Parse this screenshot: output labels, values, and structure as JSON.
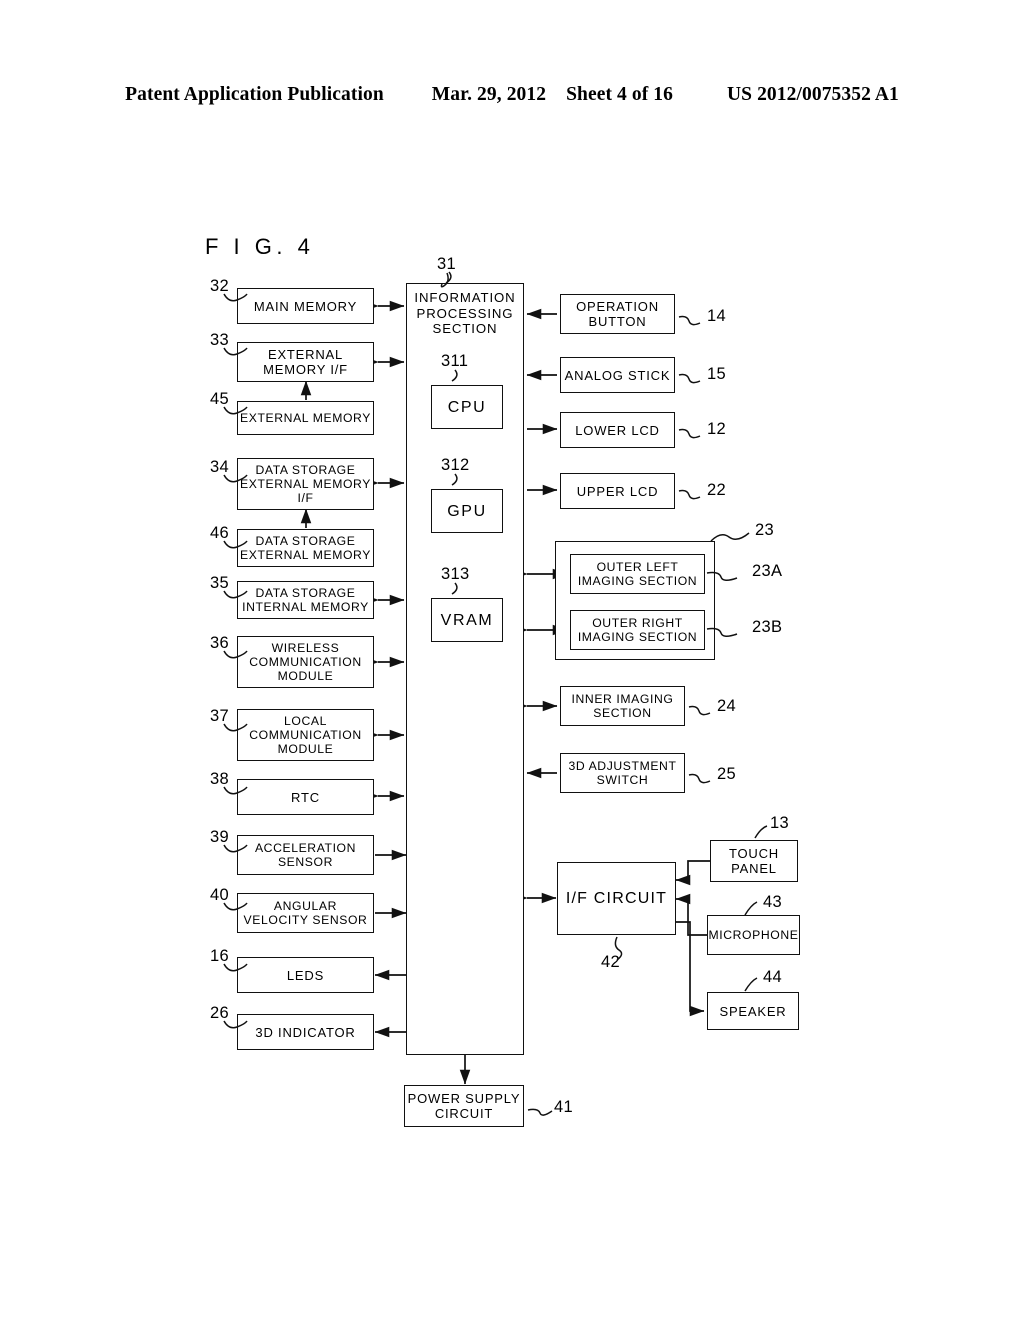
{
  "header": {
    "left": "Patent Application Publication",
    "date": "Mar. 29, 2012",
    "sheet": "Sheet 4 of 16",
    "pub_number": "US 2012/0075352 A1"
  },
  "figure": {
    "label": "F I G.  4"
  },
  "blocks": {
    "main_memory": {
      "label": "MAIN MEMORY",
      "ref": "32"
    },
    "external_memory_if": {
      "label": "EXTERNAL\nMEMORY I/F",
      "ref": "33"
    },
    "external_memory": {
      "label": "EXTERNAL MEMORY",
      "ref": "45"
    },
    "ds_external_memory_if": {
      "label": "DATA STORAGE\nEXTERNAL MEMORY\nI/F",
      "ref": "34"
    },
    "ds_external_memory": {
      "label": "DATA STORAGE\nEXTERNAL MEMORY",
      "ref": "46"
    },
    "ds_internal_memory": {
      "label": "DATA STORAGE\nINTERNAL MEMORY",
      "ref": "35"
    },
    "wireless_comm_module": {
      "label": "WIRELESS\nCOMMUNICATION\nMODULE",
      "ref": "36"
    },
    "local_comm_module": {
      "label": "LOCAL\nCOMMUNICATION\nMODULE",
      "ref": "37"
    },
    "rtc": {
      "label": "RTC",
      "ref": "38"
    },
    "acceleration_sensor": {
      "label": "ACCELERATION\nSENSOR",
      "ref": "39"
    },
    "angular_velocity_sensor": {
      "label": "ANGULAR\nVELOCITY SENSOR",
      "ref": "40"
    },
    "leds": {
      "label": "LEDS",
      "ref": "16"
    },
    "indicator_3d": {
      "label": "3D INDICATOR",
      "ref": "26"
    },
    "information_processing_section": {
      "label": "INFORMATION\nPROCESSING\nSECTION",
      "ref": "31"
    },
    "cpu": {
      "label": "CPU",
      "ref": "311"
    },
    "gpu": {
      "label": "GPU",
      "ref": "312"
    },
    "vram": {
      "label": "VRAM",
      "ref": "313"
    },
    "operation_button": {
      "label": "OPERATION\nBUTTON",
      "ref": "14"
    },
    "analog_stick": {
      "label": "ANALOG STICK",
      "ref": "15"
    },
    "lower_lcd": {
      "label": "LOWER LCD",
      "ref": "12"
    },
    "upper_lcd": {
      "label": "UPPER LCD",
      "ref": "22"
    },
    "outer_imaging_group": {
      "ref": "23"
    },
    "outer_left_imaging_section": {
      "label": "OUTER LEFT\nIMAGING SECTION",
      "ref": "23A"
    },
    "outer_right_imaging_section": {
      "label": "OUTER RIGHT\nIMAGING SECTION",
      "ref": "23B"
    },
    "inner_imaging_section": {
      "label": "INNER IMAGING\nSECTION",
      "ref": "24"
    },
    "adjustment_switch_3d": {
      "label": "3D ADJUSTMENT\nSWITCH",
      "ref": "25"
    },
    "if_circuit": {
      "label": "I/F CIRCUIT",
      "ref": "42"
    },
    "touch_panel": {
      "label": "TOUCH\nPANEL",
      "ref": "13"
    },
    "microphone": {
      "label": "MICROPHONE",
      "ref": "43"
    },
    "speaker": {
      "label": "SPEAKER",
      "ref": "44"
    },
    "power_supply_circuit": {
      "label": "POWER SUPPLY\nCIRCUIT",
      "ref": "41"
    }
  },
  "colors": {
    "ink": "#111111",
    "paper": "#ffffff"
  }
}
